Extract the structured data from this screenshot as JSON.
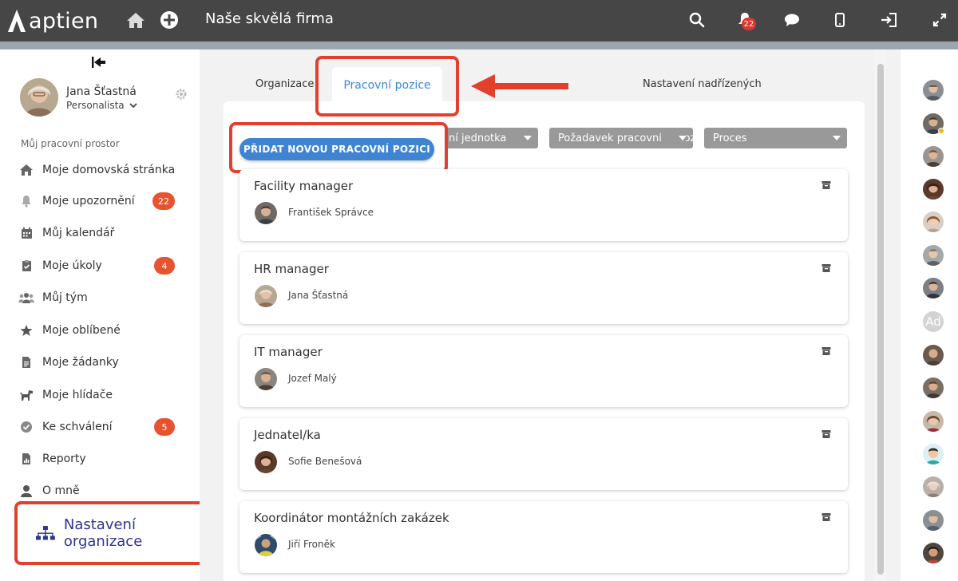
{
  "header": {
    "logo_text": "aptien",
    "company": "Naše skvělá firma",
    "notification_count": "22"
  },
  "user": {
    "name": "Jana Šťastná",
    "role": "Personalista"
  },
  "sidebar": {
    "section_title": "Můj pracovní prostor",
    "items": [
      {
        "label": "Moje domovská stránka",
        "icon": "home-icon"
      },
      {
        "label": "Moje upozornění",
        "icon": "bell-icon",
        "badge": "22"
      },
      {
        "label": "Můj kalendář",
        "icon": "calendar-icon"
      },
      {
        "label": "Moje úkoly",
        "icon": "clipboard-icon",
        "badge": "4"
      },
      {
        "label": "Můj tým",
        "icon": "team-icon"
      },
      {
        "label": "Moje oblíbené",
        "icon": "star-icon"
      },
      {
        "label": "Moje žádanky",
        "icon": "document-icon"
      },
      {
        "label": "Moje hlídače",
        "icon": "dog-icon"
      },
      {
        "label": "Ke schválení",
        "icon": "check-circle-icon",
        "badge": "5"
      },
      {
        "label": "Reporty",
        "icon": "report-icon"
      },
      {
        "label": "O mně",
        "icon": "person-icon"
      }
    ],
    "org_settings": "Nastavení organizace"
  },
  "tabs": {
    "organizace": "Organizace",
    "pracovni_pozice": "Pracovní pozice",
    "nastaveni_nadrizenych": "Nastavení nadřízených"
  },
  "filters": {
    "unit": "ní jednotka",
    "request": "Požadavek pracovních pozic",
    "process": "Proces"
  },
  "add_button": "PŘIDAT NOVOU PRACOVNÍ POZICI",
  "positions": [
    {
      "title": "Facility manager",
      "person": "František Správce"
    },
    {
      "title": "HR manager",
      "person": "Jana Šťastná"
    },
    {
      "title": "IT manager",
      "person": "Jozef Malý"
    },
    {
      "title": "Jednatel/ka",
      "person": "Sofie Benešová"
    },
    {
      "title": "Koordinátor montážních zakázek",
      "person": "Jiří Froněk"
    }
  ],
  "people_sidebar": {
    "initials_avatar": "Ad"
  },
  "colors": {
    "topbar": "#464646",
    "accent_blue": "#3f83d3",
    "highlight_red": "#e2402c",
    "badge_orange": "#e8522d",
    "org_link": "#2f3690"
  }
}
